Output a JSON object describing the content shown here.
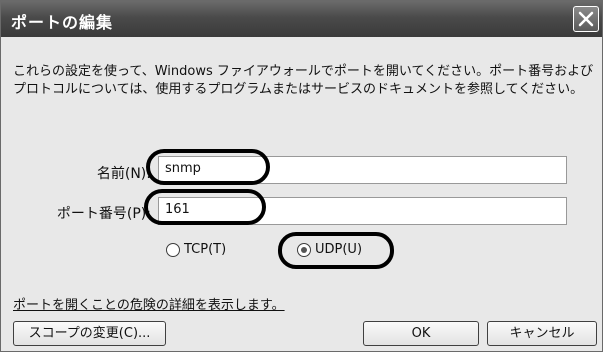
{
  "window": {
    "title": "ポートの編集",
    "description": "これらの設定を使って、Windows ファイアウォールでポートを開いてください。ポート番号およびプロトコルについては、使用するプログラムまたはサービスのドキュメントを参照してください。"
  },
  "form": {
    "name_label": "名前(N):",
    "name_value": "snmp",
    "port_label": "ポート番号(P):",
    "port_value": "161",
    "protocol": {
      "tcp_label": "TCP(T)",
      "udp_label": "UDP(U)",
      "selected": "UDP(U)"
    }
  },
  "links": {
    "risk": "ポートを開くことの危険の詳細を表示します。"
  },
  "buttons": {
    "scope": "スコープの変更(C)...",
    "ok": "OK",
    "cancel": "キャンセル"
  },
  "icons": {
    "close": "close-icon"
  }
}
